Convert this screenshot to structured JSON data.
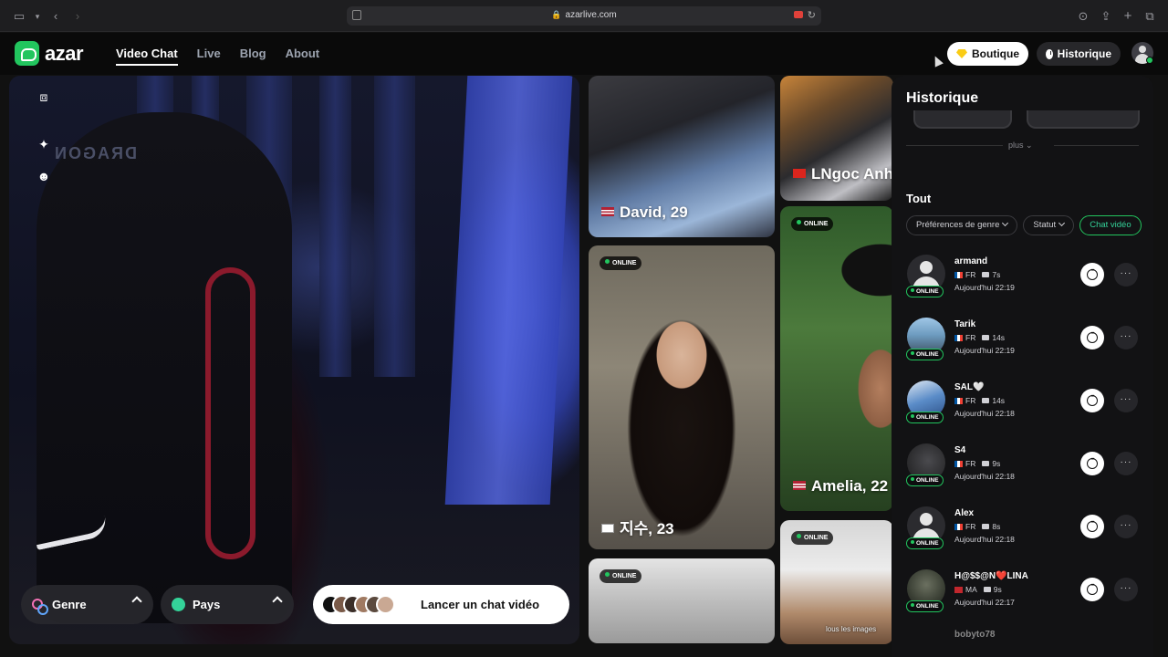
{
  "browser": {
    "url": "azarlive.com"
  },
  "header": {
    "logo_text": "azar",
    "nav": [
      {
        "label": "Video Chat",
        "active": true
      },
      {
        "label": "Live",
        "active": false
      },
      {
        "label": "Blog",
        "active": false
      },
      {
        "label": "About",
        "active": false
      }
    ],
    "boutique_label": "Boutique",
    "historique_label": "Historique"
  },
  "camera": {
    "brand_text": "DRAGON",
    "tools": [
      "expand-icon",
      "sparkle-icon",
      "face-icon"
    ]
  },
  "controls": {
    "genre_label": "Genre",
    "pays_label": "Pays",
    "cta_label": "Lancer un chat vidéo"
  },
  "cards": [
    {
      "label": "David, 29",
      "flag": "US",
      "online": false
    },
    {
      "label": "LNgoc Anh",
      "flag": "VN",
      "online": false
    },
    {
      "label": "지수, 23",
      "flag": "KR",
      "online": true
    },
    {
      "label": "Amelia, 22",
      "flag": "US",
      "online": true
    },
    {
      "label": "",
      "flag": "",
      "online": true
    },
    {
      "label": "",
      "flag": "",
      "online": true
    }
  ],
  "online_badge": "ONLINE",
  "card_caption": "lous les images",
  "panel": {
    "title": "Historique",
    "plus_label": "plus",
    "section_label": "Tout",
    "filters": [
      {
        "label": "Préférences de genre",
        "active": false
      },
      {
        "label": "Statut",
        "active": false
      },
      {
        "label": "Chat vidéo",
        "active": true
      }
    ],
    "history": [
      {
        "name": "armand",
        "country": "FR",
        "duration": "7s",
        "time": "Aujourd'hui 22:19",
        "avatar": "default"
      },
      {
        "name": "Tarik",
        "country": "FR",
        "duration": "14s",
        "time": "Aujourd'hui 22:19",
        "avatar": "photo"
      },
      {
        "name": "SAL🤍",
        "country": "FR",
        "duration": "14s",
        "time": "Aujourd'hui 22:18",
        "avatar": "photo"
      },
      {
        "name": "S4",
        "country": "FR",
        "duration": "9s",
        "time": "Aujourd'hui 22:18",
        "avatar": "photo"
      },
      {
        "name": "Alex",
        "country": "FR",
        "duration": "8s",
        "time": "Aujourd'hui 22:18",
        "avatar": "default"
      },
      {
        "name": "H@$$@N❤️LINA",
        "country": "MA",
        "duration": "9s",
        "time": "Aujourd'hui 22:17",
        "avatar": "photo"
      }
    ],
    "partial_name": "bobyto78"
  },
  "colors": {
    "accent": "#22c55e",
    "background": "#0a0a0a"
  }
}
